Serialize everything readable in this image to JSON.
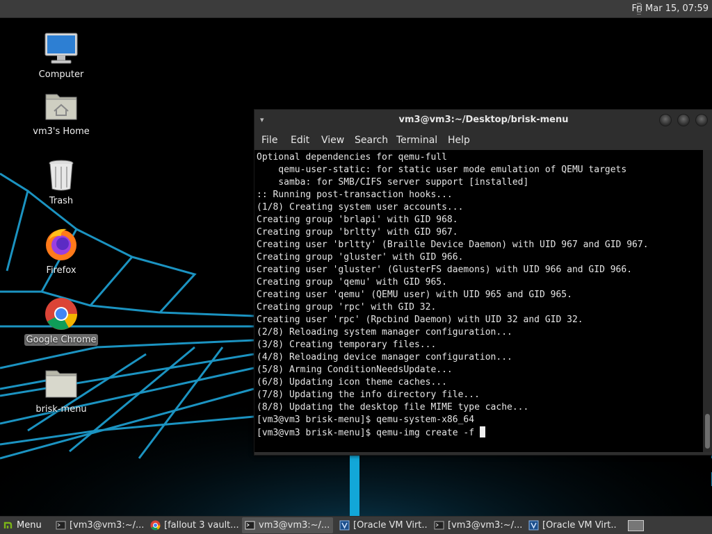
{
  "top_panel": {
    "clock": "Fri Mar 15, 07:59"
  },
  "desktop_icons": [
    {
      "label": "Computer",
      "icon": "computer-icon"
    },
    {
      "label": "vm3's Home",
      "icon": "home-folder-icon"
    },
    {
      "label": "Trash",
      "icon": "trash-icon"
    },
    {
      "label": "Firefox",
      "icon": "firefox-icon"
    },
    {
      "label": "Google Chrome",
      "icon": "chrome-icon",
      "selected": true
    },
    {
      "label": "brisk-menu",
      "icon": "folder-icon"
    }
  ],
  "terminal": {
    "title": "vm3@vm3:~/Desktop/brisk-menu",
    "menu": [
      "File",
      "Edit",
      "View",
      "Search",
      "Terminal",
      "Help"
    ],
    "lines": [
      "Optional dependencies for qemu-full",
      "    qemu-user-static: for static user mode emulation of QEMU targets",
      "    samba: for SMB/CIFS server support [installed]",
      ":: Running post-transaction hooks...",
      "(1/8) Creating system user accounts...",
      "Creating group 'brlapi' with GID 968.",
      "Creating group 'brltty' with GID 967.",
      "Creating user 'brltty' (Braille Device Daemon) with UID 967 and GID 967.",
      "Creating group 'gluster' with GID 966.",
      "Creating user 'gluster' (GlusterFS daemons) with UID 966 and GID 966.",
      "Creating group 'qemu' with GID 965.",
      "Creating user 'qemu' (QEMU user) with UID 965 and GID 965.",
      "Creating group 'rpc' with GID 32.",
      "Creating user 'rpc' (Rpcbind Daemon) with UID 32 and GID 32.",
      "(2/8) Reloading system manager configuration...",
      "(3/8) Creating temporary files...",
      "(4/8) Reloading device manager configuration...",
      "(5/8) Arming ConditionNeedsUpdate...",
      "(6/8) Updating icon theme caches...",
      "(7/8) Updating the info directory file...",
      "(8/8) Updating the desktop file MIME type cache...",
      "[vm3@vm3 brisk-menu]$ qemu-system-x86_64"
    ],
    "prompt_line": "[vm3@vm3 brisk-menu]$ qemu-img create -f "
  },
  "taskbar": {
    "menu_label": "Menu",
    "tasks": [
      {
        "label": "[vm3@vm3:~/...",
        "icon": "terminal-icon",
        "active": false
      },
      {
        "label": "[fallout 3 vault...",
        "icon": "chrome-icon",
        "active": false
      },
      {
        "label": "vm3@vm3:~/...",
        "icon": "terminal-icon",
        "active": true
      },
      {
        "label": "[Oracle VM Virt...",
        "icon": "virtualbox-icon",
        "active": false
      },
      {
        "label": "[vm3@vm3:~/...",
        "icon": "terminal-icon",
        "active": false
      },
      {
        "label": "[Oracle VM Virt...",
        "icon": "virtualbox-icon",
        "active": false
      }
    ]
  },
  "colors": {
    "terminal_bg": "#000000",
    "panel_bg": "#3a3a3a",
    "wallpaper_grid": "#1fa3d6"
  }
}
